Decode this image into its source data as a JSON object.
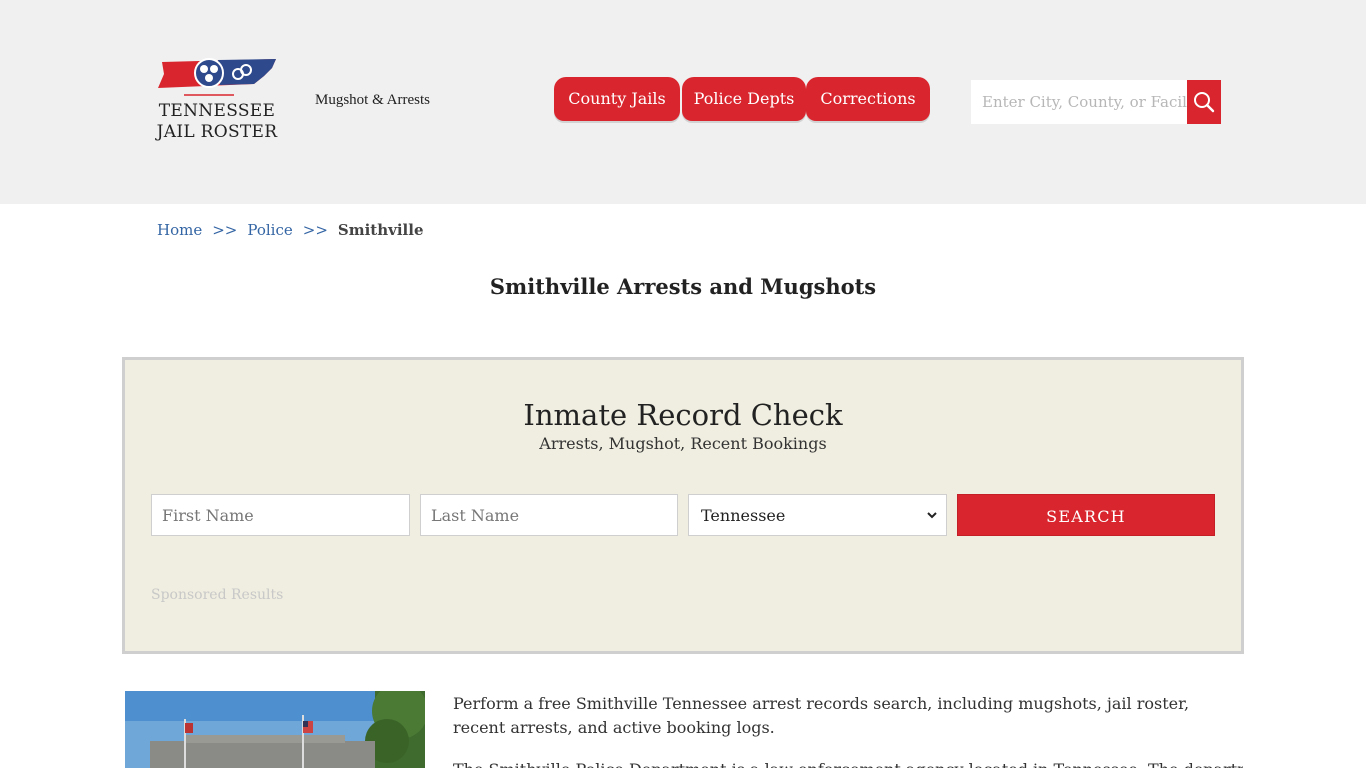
{
  "header": {
    "logo_line1": "TENNESSEE",
    "logo_line2": "JAIL ROSTER",
    "tagline": "Mugshot & Arrests",
    "nav": [
      "County Jails",
      "Police Depts",
      "Corrections"
    ],
    "search_placeholder": "Enter City, County, or Facil"
  },
  "breadcrumb": {
    "home": "Home",
    "sep": ">>",
    "police": "Police",
    "current": "Smithville"
  },
  "page_title": "Smithville Arrests and Mugshots",
  "record_check": {
    "title": "Inmate Record Check",
    "subtitle": "Arrests, Mugshot, Recent Bookings",
    "first_placeholder": "First Name",
    "last_placeholder": "Last Name",
    "state_selected": "Tennessee",
    "search_label": "SEARCH",
    "sponsored": "Sponsored Results"
  },
  "content": {
    "para1": "Perform a free Smithville Tennessee arrest records search, including mugshots, jail roster, recent arrests, and active booking logs.",
    "para2": "The Smithville Police Department is a law enforcement agency located in Tennessee. The department is"
  },
  "colors": {
    "accent": "#d9262e",
    "header_bg": "#f0f0f0",
    "box_bg": "#f0eee0",
    "link": "#3465a4"
  }
}
